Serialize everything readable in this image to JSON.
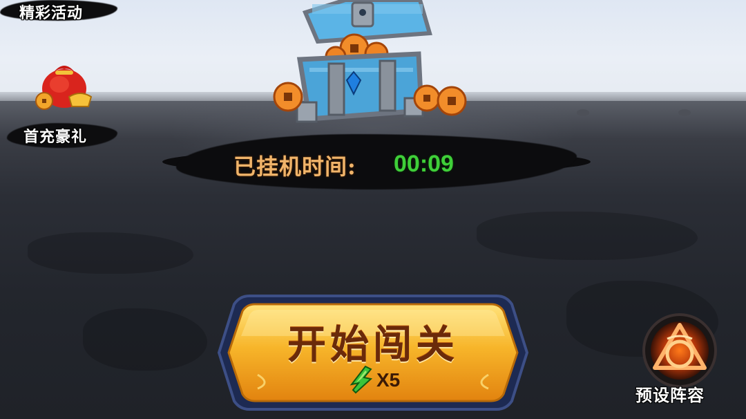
{
  "events": {
    "label": "精彩活动"
  },
  "first_recharge": {
    "label": "首充豪礼",
    "icon": "red-gift-bag-icon"
  },
  "treasure": {
    "icon": "treasure-chest-icon"
  },
  "idle": {
    "label": "已挂机时间:",
    "value": "00:09"
  },
  "start": {
    "label": "开始闯关",
    "cost": "X5",
    "cost_icon": "green-lightning-energy-icon"
  },
  "preset": {
    "label": "预设阵容",
    "icon": "formation-emblem-icon"
  },
  "colors": {
    "idle_label": "#f0b46a",
    "idle_value": "#3fcf39",
    "button_gold": "#f7a81f",
    "button_text": "#6b2a0a"
  }
}
